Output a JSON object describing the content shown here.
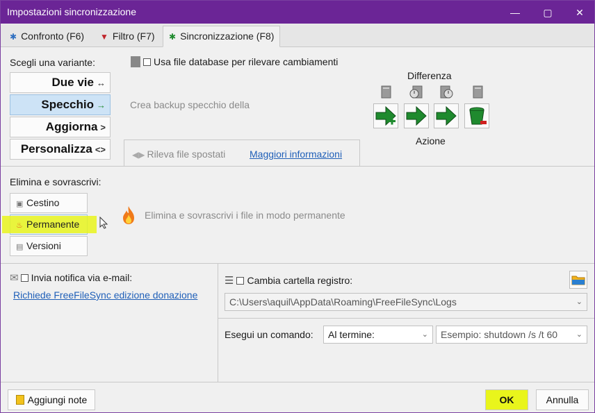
{
  "window": {
    "title": "Impostazioni sincronizzazione",
    "minimize_glyph": "—",
    "maximize_glyph": "▢",
    "close_glyph": "✕"
  },
  "tabs": [
    {
      "label": "Confronto (F6)",
      "icon": "gear-icon"
    },
    {
      "label": "Filtro (F7)",
      "icon": "funnel-icon"
    },
    {
      "label": "Sincronizzazione (F8)",
      "icon": "sync-gear-icon"
    }
  ],
  "variant": {
    "heading": "Scegli una variante:",
    "options": [
      {
        "label": "Due vie",
        "arrow": "↔"
      },
      {
        "label": "Specchio",
        "arrow": "→"
      },
      {
        "label": "Aggiorna",
        "arrow": ">"
      },
      {
        "label": "Personalizza",
        "arrow": "<>"
      }
    ],
    "selected": "Specchio",
    "database_label": "Usa file database per rilevare cambiamenti",
    "description": "Crea backup specchio della",
    "detect_moved": "Rileva file spostati",
    "more_info": "Maggiori informazioni"
  },
  "difference": {
    "heading": "Differenza",
    "action_heading": "Azione"
  },
  "delete": {
    "heading": "Elimina e sovrascrivi:",
    "options": [
      {
        "label": "Cestino",
        "icon": "recycle-bin-icon"
      },
      {
        "label": "Permanente",
        "icon": "flame-icon"
      },
      {
        "label": "Versioni",
        "icon": "versions-icon"
      }
    ],
    "selected": "Permanente",
    "description": "Elimina e sovrascrivi i file in modo permanente"
  },
  "email": {
    "label": "Invia notifica via e-mail:",
    "link": "Richiede FreeFileSync edizione donazione"
  },
  "log": {
    "label": "Cambia cartella registro:",
    "path": "C:\\Users\\aquil\\AppData\\Roaming\\FreeFileSync\\Logs"
  },
  "command": {
    "label": "Esegui un comando:",
    "when": "Al termine:",
    "example": "Esempio: shutdown /s /t 60"
  },
  "footer": {
    "notes": "Aggiungi note",
    "ok": "OK",
    "cancel": "Annulla"
  },
  "colors": {
    "titlebar": "#6b2596",
    "highlight": "#e9f51c",
    "selected_variant": "#cde3f6",
    "action_green": "#1f8a2e",
    "link": "#1f5fb8"
  }
}
